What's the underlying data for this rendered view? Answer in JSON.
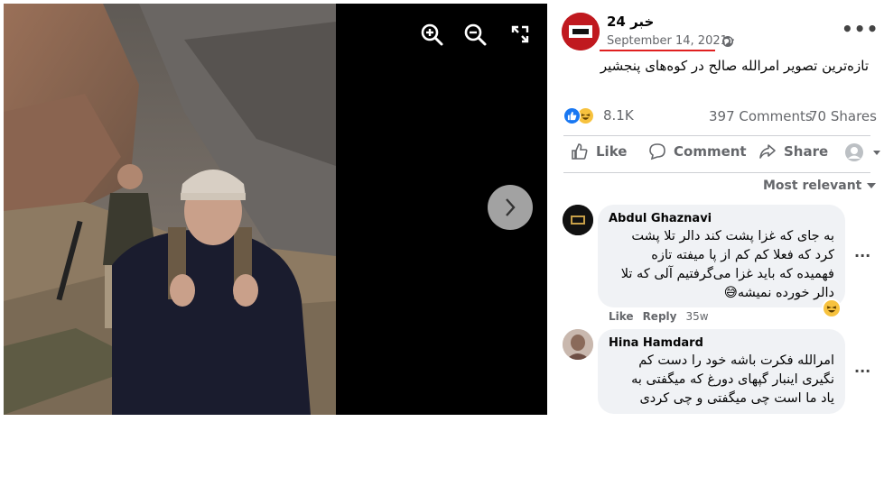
{
  "viewer": {
    "controls": [
      "zoom-in",
      "zoom-out",
      "fullscreen",
      "next"
    ]
  },
  "post": {
    "page_name": "خبر 24",
    "date": "September 14, 2021",
    "date_separator": "·",
    "audience_icon": "globe-icon",
    "text": "تازه‌ترین تصویر امرالله صالح در کوه‌های پنجشیر",
    "reaction_icons": [
      "like-icon",
      "haha-icon"
    ],
    "reaction_count": "8.1K",
    "comment_count": "397 Comments",
    "share_count": "70 Shares"
  },
  "actions": {
    "like": "Like",
    "comment": "Comment",
    "share": "Share"
  },
  "comments_sort": "Most relevant",
  "comments": [
    {
      "author": "Abdul Ghaznavi",
      "lines": [
        "به جای که غزا پشت کند دالر تلا پشت",
        "کرد که فعلا کم کم از پا میفته تازه",
        "فهمیده که باید غزا می‌گرفتیم آلی که تلا",
        "دالر خورده نمیشه😅"
      ],
      "like_label": "Like",
      "reply_label": "Reply",
      "time": "35w",
      "reaction_icon": "haha-icon"
    },
    {
      "author": "Hina Hamdard",
      "lines": [
        "امرالله فکرت باشه خود را دست کم",
        "نگیری اینبار گپهای دورغ که میگفتی به",
        "یاد ما است چی میگفتی و چی کردی"
      ]
    }
  ],
  "colors": {
    "facebook_blue": "#1877f2",
    "secondary_text": "#65676b",
    "bubble_bg": "#f0f2f5",
    "annotation_red": "#e02020",
    "viewer_bg": "#000000"
  }
}
